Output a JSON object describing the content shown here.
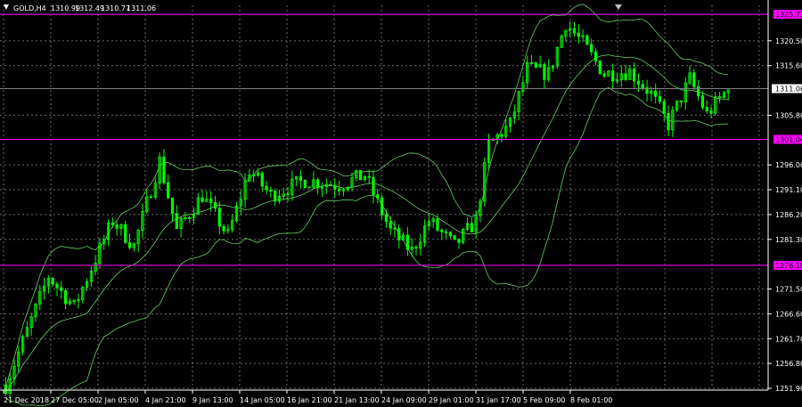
{
  "chart_data": {
    "type": "candlestick",
    "symbol": "GOLD,H4",
    "ohlc_header": {
      "open": "1310.99",
      "high": "1312.49",
      "low": "1310.77",
      "close": "1311.06"
    },
    "ylim": [
      1251.9,
      1327.5
    ],
    "y_ticks": [
      "1320.50",
      "1315.60",
      "1305.80",
      "1296.00",
      "1291.10",
      "1286.20",
      "1281.30",
      "1271.50",
      "1266.60",
      "1261.70",
      "1256.80",
      "1251.90"
    ],
    "x_ticks": [
      "21 Dec 2018",
      "27 Dec 05:00",
      "2 Jan 05:00",
      "4 Jan 21:00",
      "9 Jan 13:00",
      "14 Jan 05:00",
      "16 Jan 21:00",
      "21 Jan 13:00",
      "24 Jan 09:00",
      "29 Jan 01:00",
      "31 Jan 17:00",
      "5 Feb 09:00",
      "8 Feb 01:00"
    ],
    "levels": [
      {
        "name": "1325.73",
        "value": 1325.73,
        "color": "#ff00ff"
      },
      {
        "name": "1301.04",
        "value": 1301.04,
        "color": "#ff00ff"
      },
      {
        "name": "1276.18",
        "value": 1276.18,
        "color": "#ff00ff"
      }
    ],
    "current_price": {
      "label": "1311.06",
      "value": 1311.06
    },
    "candle_count": 170,
    "close_path": [
      [
        0,
        1252.5
      ],
      [
        10,
        1274.0
      ],
      [
        16,
        1268.0
      ],
      [
        25,
        1285.0
      ],
      [
        30,
        1280.0
      ],
      [
        36,
        1296.8
      ],
      [
        40,
        1283.0
      ],
      [
        46,
        1290.0
      ],
      [
        52,
        1282.0
      ],
      [
        57,
        1295.0
      ],
      [
        62,
        1290.0
      ],
      [
        70,
        1293.0
      ],
      [
        78,
        1292.0
      ],
      [
        84,
        1294.0
      ],
      [
        90,
        1283.0
      ],
      [
        95,
        1279.0
      ],
      [
        99,
        1285.0
      ],
      [
        105,
        1280.0
      ],
      [
        110,
        1285.0
      ],
      [
        113,
        1300.0
      ],
      [
        118,
        1304.0
      ],
      [
        122,
        1315.0
      ],
      [
        127,
        1314.0
      ],
      [
        131,
        1324.0
      ],
      [
        135,
        1320.0
      ],
      [
        140,
        1314.0
      ],
      [
        146,
        1314.5
      ],
      [
        151,
        1310.0
      ],
      [
        155,
        1304.0
      ],
      [
        160,
        1313.0
      ],
      [
        164,
        1306.0
      ],
      [
        169,
        1311.06
      ]
    ],
    "colors": {
      "background": "#000000",
      "grid": "#c0c0c0",
      "candle": "#00ff00",
      "bands": "#66cc66",
      "level": "#ff00ff",
      "current_line": "#808080",
      "axis": "#ffffff"
    }
  }
}
